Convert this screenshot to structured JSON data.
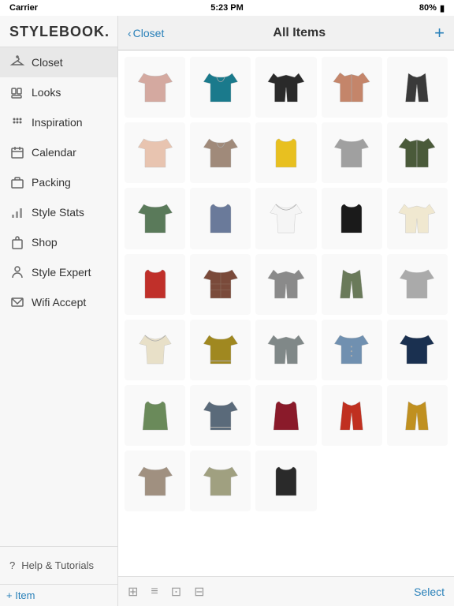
{
  "statusBar": {
    "carrier": "Carrier",
    "time": "5:23 PM",
    "battery": "80%"
  },
  "sidebar": {
    "logo": "STYLEBOOK.",
    "navItems": [
      {
        "id": "closet",
        "label": "Closet",
        "icon": "hanger",
        "active": true
      },
      {
        "id": "looks",
        "label": "Looks",
        "icon": "heart",
        "active": false
      },
      {
        "id": "inspiration",
        "label": "Inspiration",
        "icon": "star",
        "active": false
      },
      {
        "id": "calendar",
        "label": "Calendar",
        "icon": "calendar",
        "active": false
      },
      {
        "id": "packing",
        "label": "Packing",
        "icon": "suitcase",
        "active": false
      },
      {
        "id": "style-stats",
        "label": "Style Stats",
        "icon": "chart",
        "active": false
      },
      {
        "id": "shop",
        "label": "Shop",
        "icon": "bag",
        "active": false
      },
      {
        "id": "style-expert",
        "label": "Style Expert",
        "icon": "person",
        "active": false
      },
      {
        "id": "wifi-accept",
        "label": "Wifi Accept",
        "icon": "envelope",
        "active": false
      }
    ],
    "bottomItem": "Help & Tutorials",
    "addItemLabel": "+ Item"
  },
  "header": {
    "backLabel": "Closet",
    "title": "All Items",
    "addIcon": "+"
  },
  "grid": {
    "items": [
      {
        "id": 1,
        "color": "#d4a9a0",
        "type": "tshirt"
      },
      {
        "id": 2,
        "color": "#1a7a8c",
        "type": "hoodie"
      },
      {
        "id": 3,
        "color": "#2a2a2a",
        "type": "cardigan"
      },
      {
        "id": 4,
        "color": "#c4856a",
        "type": "jacket"
      },
      {
        "id": 5,
        "color": "#3a3a3a",
        "type": "vest"
      },
      {
        "id": 6,
        "color": "#e8c4b0",
        "type": "tshirt"
      },
      {
        "id": 7,
        "color": "#a08a7a",
        "type": "hoodie"
      },
      {
        "id": 8,
        "color": "#e8c020",
        "type": "tank"
      },
      {
        "id": 9,
        "color": "#a0a0a0",
        "type": "tshirt"
      },
      {
        "id": 10,
        "color": "#4a5a3a",
        "type": "jacket"
      },
      {
        "id": 11,
        "color": "#5a7a5a",
        "type": "tshirt"
      },
      {
        "id": 12,
        "color": "#6a7a9a",
        "type": "tank"
      },
      {
        "id": 13,
        "color": "#f5f5f5",
        "type": "blouse"
      },
      {
        "id": 14,
        "color": "#1a1a1a",
        "type": "tank"
      },
      {
        "id": 15,
        "color": "#f0e8d0",
        "type": "cardigan"
      },
      {
        "id": 16,
        "color": "#c0302a",
        "type": "tank"
      },
      {
        "id": 17,
        "color": "#7a4a3a",
        "type": "flannel"
      },
      {
        "id": 18,
        "color": "#8a8a8a",
        "type": "cardigan"
      },
      {
        "id": 19,
        "color": "#6a7a5a",
        "type": "vest"
      },
      {
        "id": 20,
        "color": "#aaaaaa",
        "type": "tshirt"
      },
      {
        "id": 21,
        "color": "#e8e0c8",
        "type": "blouse"
      },
      {
        "id": 22,
        "color": "#a08820",
        "type": "sweater"
      },
      {
        "id": 23,
        "color": "#808888",
        "type": "cardigan"
      },
      {
        "id": 24,
        "color": "#7090b0",
        "type": "shirt"
      },
      {
        "id": 25,
        "color": "#1a3050",
        "type": "tshirt"
      },
      {
        "id": 26,
        "color": "#6a8a5a",
        "type": "dress"
      },
      {
        "id": 27,
        "color": "#5a6a7a",
        "type": "sweater"
      },
      {
        "id": 28,
        "color": "#8a1a2a",
        "type": "dress"
      },
      {
        "id": 29,
        "color": "#c03020",
        "type": "vest"
      },
      {
        "id": 30,
        "color": "#c09020",
        "type": "vest"
      },
      {
        "id": 31,
        "color": "#a09080",
        "type": "tshirt"
      },
      {
        "id": 32,
        "color": "#a0a080",
        "type": "tshirt"
      },
      {
        "id": 33,
        "color": "#2a2a2a",
        "type": "tank"
      }
    ]
  },
  "toolbar": {
    "selectLabel": "Select",
    "addItemLabel": "+ Item"
  }
}
